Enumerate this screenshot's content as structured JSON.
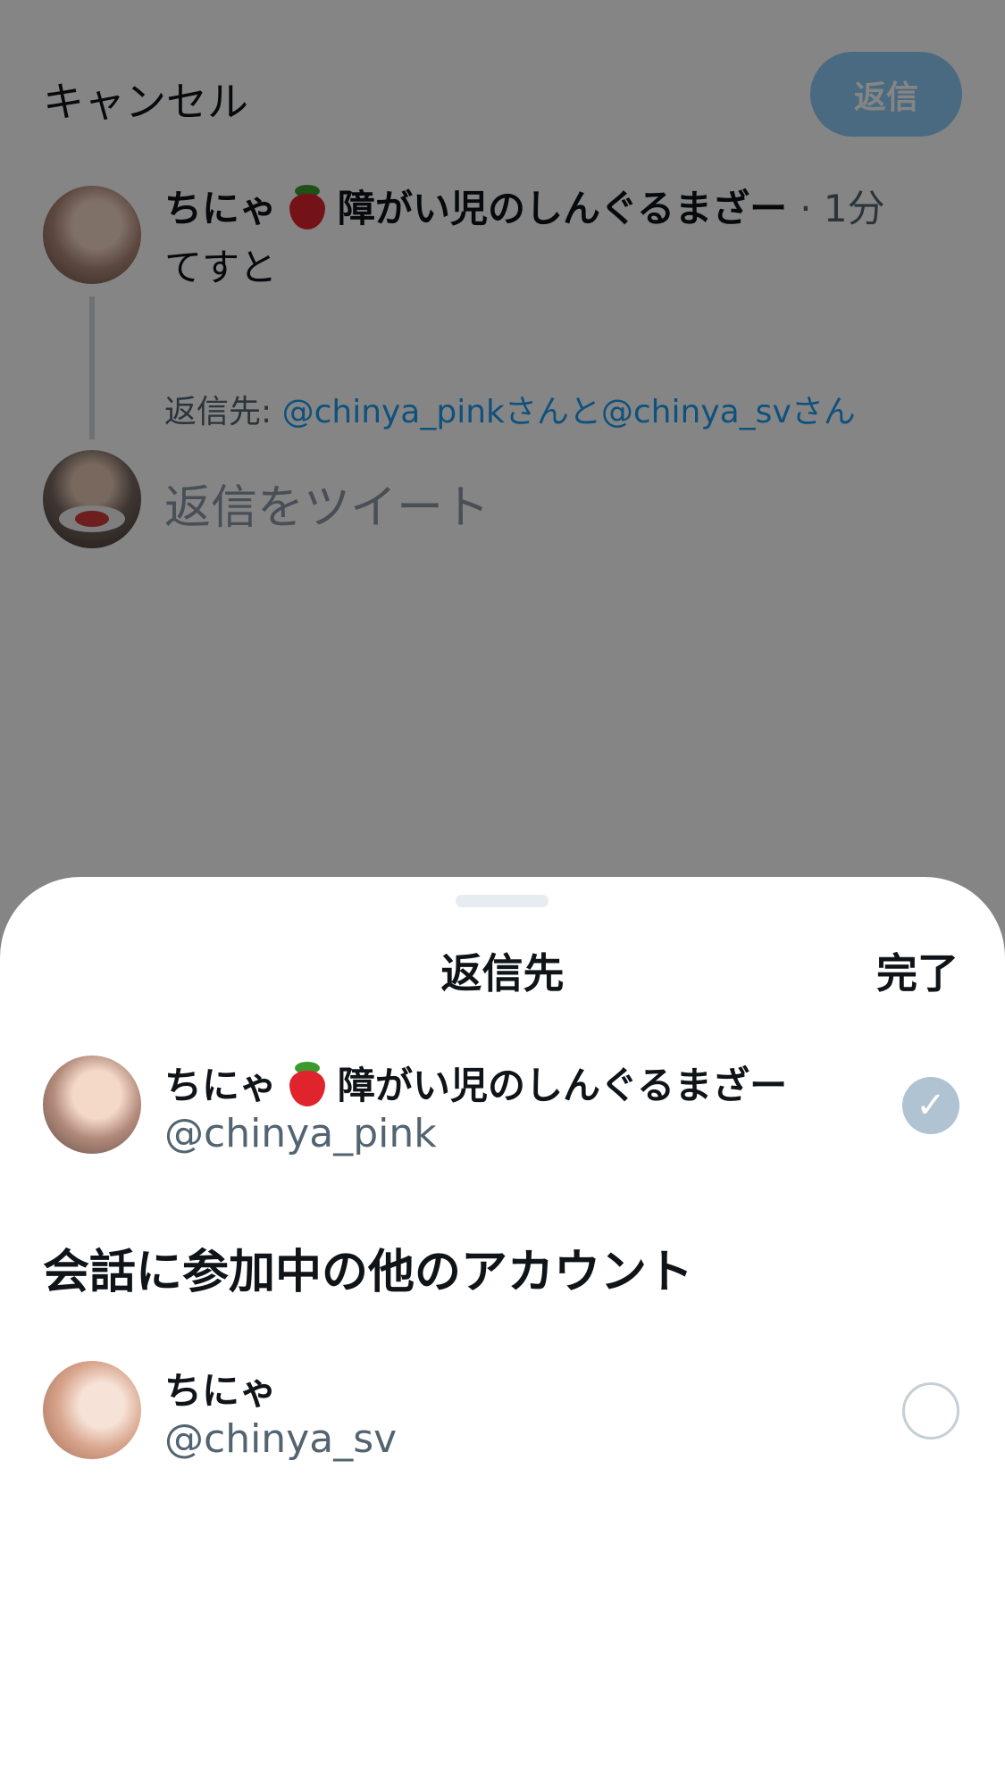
{
  "compose": {
    "cancel_label": "キャンセル",
    "reply_button_label": "返信",
    "tweet": {
      "author_name": "ちにゃ",
      "author_suffix": "障がい児のしんぐるまざー",
      "time": "· 1分",
      "text": "てすと"
    },
    "reply_to": {
      "prefix": "返信先: ",
      "users": "@chinya_pinkさんと@chinya_svさん"
    },
    "input_placeholder": "返信をツイート"
  },
  "sheet": {
    "title": "返信先",
    "done_label": "完了",
    "primary_account": {
      "name": "ちにゃ",
      "name_suffix": "障がい児のしんぐるまざー",
      "handle": "@chinya_pink",
      "selected": true
    },
    "section_heading": "会話に参加中の他のアカウント",
    "other_accounts": [
      {
        "name": "ちにゃ",
        "handle": "@chinya_sv",
        "selected": false
      }
    ]
  },
  "colors": {
    "accent": "#1d9bf0",
    "secondary_text": "#536471",
    "check_fill": "#afc3d2"
  },
  "icons": {
    "strawberry": "strawberry-emoji-icon",
    "checkmark": "check-icon"
  }
}
